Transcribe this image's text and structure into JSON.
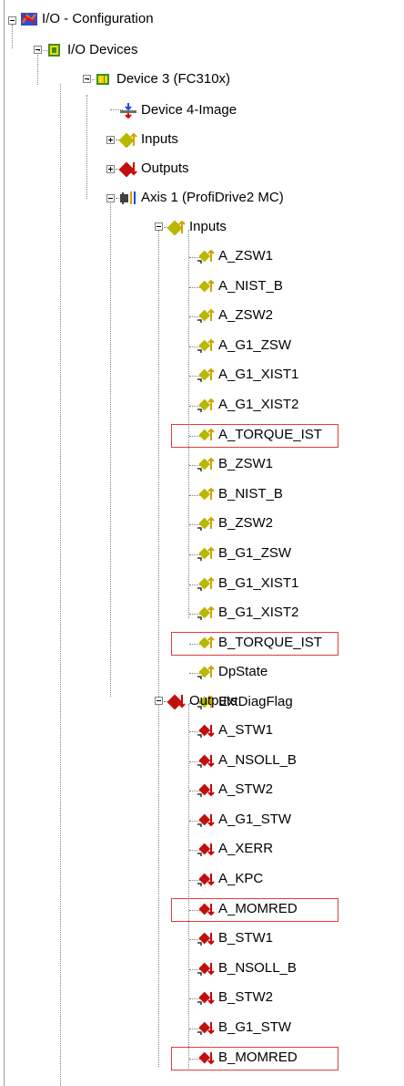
{
  "tree": {
    "root": "I/O - Configuration",
    "io_devices": "I/O Devices",
    "device": "Device 3 (FC310x)",
    "image": "Device 4-Image",
    "inputs": "Inputs",
    "outputs": "Outputs",
    "axis": "Axis 1 (ProfiDrive2 MC)",
    "axis_inputs": "Inputs",
    "axis_input_items": [
      "A_ZSW1",
      "A_NIST_B",
      "A_ZSW2",
      "A_G1_ZSW",
      "A_G1_XIST1",
      "A_G1_XIST2",
      "A_TORQUE_IST",
      "B_ZSW1",
      "B_NIST_B",
      "B_ZSW2",
      "B_G1_ZSW",
      "B_G1_XIST1",
      "B_G1_XIST2",
      "B_TORQUE_IST",
      "DpState",
      "ExtDiagFlag"
    ],
    "axis_outputs": "Outputs",
    "axis_output_items": [
      "A_STW1",
      "A_NSOLL_B",
      "A_STW2",
      "A_G1_STW",
      "A_XERR",
      "A_KPC",
      "A_MOMRED",
      "B_STW1",
      "B_NSOLL_B",
      "B_STW2",
      "B_G1_STW",
      "B_MOMRED"
    ]
  },
  "highlights": [
    "A_TORQUE_IST",
    "B_TORQUE_IST",
    "A_MOMRED",
    "B_MOMRED"
  ],
  "colors": {
    "highlight_border": "#e83a3a",
    "input_arrow": "#d4a300",
    "output_arrow": "#d00000"
  }
}
